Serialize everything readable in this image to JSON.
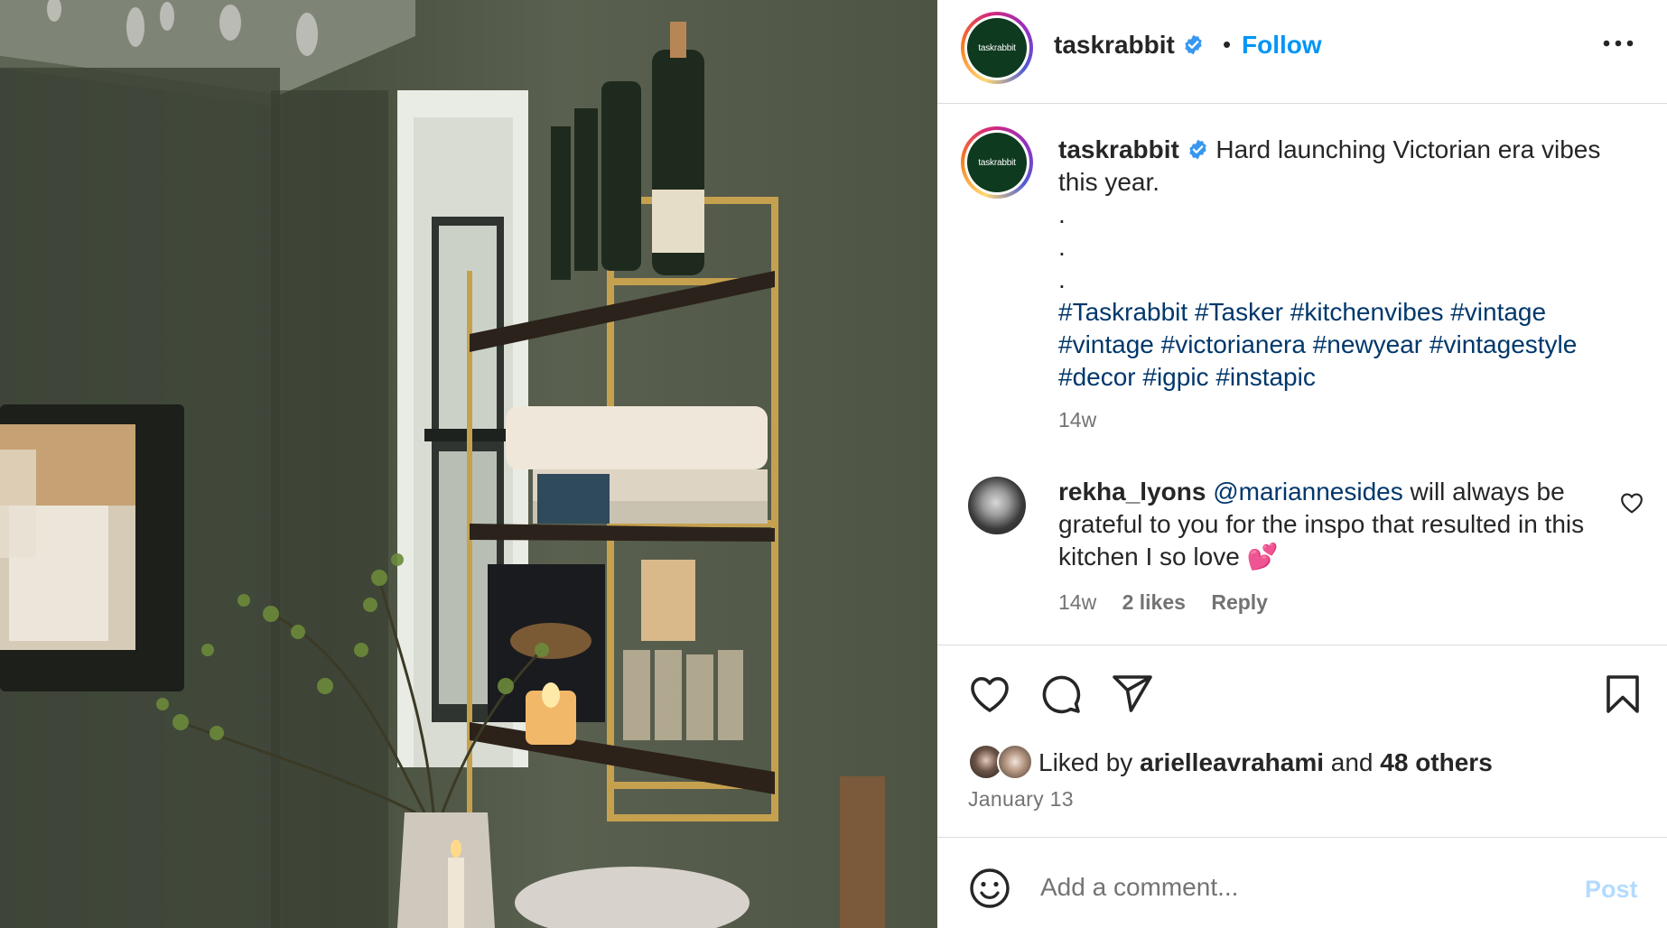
{
  "post": {
    "account": {
      "username": "taskrabbit",
      "avatar_text": "taskrabbit",
      "verified": true,
      "separator": "•",
      "follow_label": "Follow"
    },
    "caption": {
      "username": "taskrabbit",
      "text": "Hard launching Victorian era vibes this year.",
      "dots": [
        ".",
        ".",
        "."
      ],
      "hashtags": "#Taskrabbit #Tasker #kitchenvibes #vintage #vintage #victorianera #newyear #vintagestyle #decor #igpic #instapic",
      "time": "14w"
    },
    "comments": [
      {
        "username": "rekha_lyons",
        "mention": "@mariannesides",
        "text": "will always be grateful to you for the inspo that resulted in this kitchen I so love 💕",
        "time": "14w",
        "likes": "2 likes",
        "reply_label": "Reply"
      }
    ],
    "likes": {
      "prefix": "Liked by",
      "liker": "arielleavrahami",
      "joiner": "and",
      "others": "48 others"
    },
    "date": "January 13",
    "comment_box": {
      "placeholder": "Add a comment...",
      "post_label": "Post"
    },
    "icons": {
      "like": "heart-icon",
      "comment": "comment-bubble-icon",
      "share": "paper-plane-icon",
      "save": "bookmark-icon",
      "more": "more-options-icon",
      "emoji": "emoji-icon"
    },
    "colors": {
      "follow": "#0095f6",
      "hashtag": "#00376b",
      "secondary_text": "#737373",
      "post_disabled": "#b3dbff",
      "divider": "#dbdbdb"
    }
  }
}
